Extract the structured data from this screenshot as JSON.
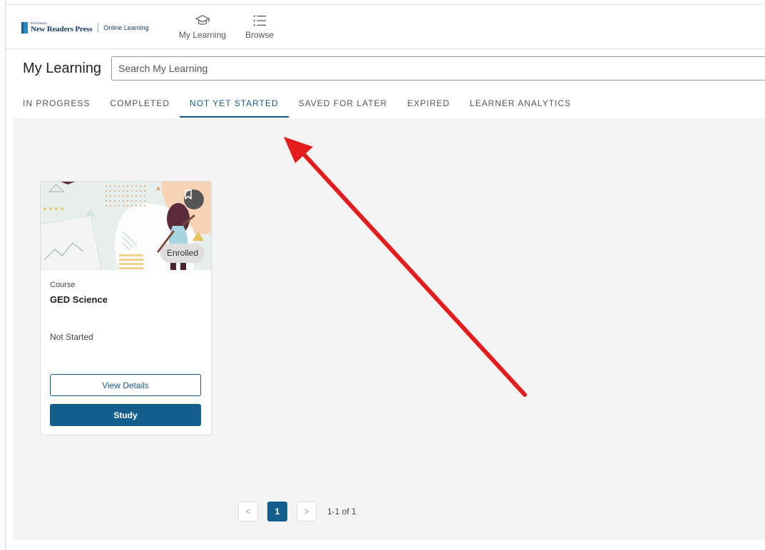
{
  "brand": {
    "small_text": "ProLiteracy",
    "name": "New Readers Press",
    "sub": "Online Learning"
  },
  "nav": {
    "my_learning": "My Learning",
    "browse": "Browse"
  },
  "page": {
    "title": "My Learning",
    "search_placeholder": "Search My Learning"
  },
  "tabs": [
    {
      "label": "IN PROGRESS"
    },
    {
      "label": "COMPLETED"
    },
    {
      "label": "NOT YET STARTED",
      "active": true
    },
    {
      "label": "SAVED FOR LATER"
    },
    {
      "label": "EXPIRED"
    },
    {
      "label": "LEARNER ANALYTICS"
    }
  ],
  "card": {
    "badge": "Enrolled",
    "type": "Course",
    "title": "GED Science",
    "status": "Not Started",
    "view_details": "View Details",
    "study": "Study"
  },
  "pagination": {
    "prev": "<",
    "current": "1",
    "next": ">",
    "range": "1-1 of 1"
  },
  "colors": {
    "accent": "#135e8c",
    "annotation_arrow": "#e51c1c"
  }
}
